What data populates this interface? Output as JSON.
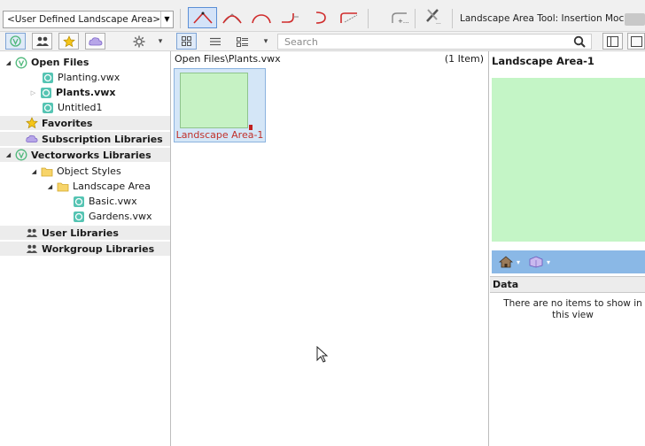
{
  "toolbar": {
    "class_select_value": "<User Defined Landscape Area>",
    "tool_mode_label": "Landscape Area Tool: Insertion Moc···",
    "mode_icons": [
      "polyline-corner-icon",
      "polyline-bezier-icon",
      "polyline-cubic-icon",
      "polyline-tangent-arc-icon",
      "polyline-point-arc-icon",
      "polyline-radius-icon",
      "rect-mode-icon",
      "settings-tools-icon"
    ]
  },
  "resource_manager": {
    "search_placeholder": "Search",
    "buttons": [
      "vectorworks-libraries-icon",
      "user-libraries-icon",
      "favorites-icon",
      "subscriptions-icon",
      "gear-icon",
      "grid-view-icon",
      "list-view-icon",
      "detail-view-icon",
      "search-icon",
      "panel-layout-icon"
    ]
  },
  "tree": {
    "items": [
      {
        "label": "Open Files",
        "bold": true,
        "expanded": true
      },
      {
        "label": "Planting.vwx",
        "bold": false
      },
      {
        "label": "Plants.vwx",
        "bold": true,
        "collapsed": true
      },
      {
        "label": "Untitled1",
        "bold": false
      },
      {
        "label": "Favorites",
        "bold": true
      },
      {
        "label": "Subscription Libraries",
        "bold": true
      },
      {
        "label": "Vectorworks Libraries",
        "bold": true,
        "expanded": true
      },
      {
        "label": "Object Styles",
        "bold": false,
        "expanded": true
      },
      {
        "label": "Landscape Area",
        "bold": false,
        "expanded": true
      },
      {
        "label": "Basic.vwx",
        "bold": false
      },
      {
        "label": "Gardens.vwx",
        "bold": false
      },
      {
        "label": "User Libraries",
        "bold": true
      },
      {
        "label": "Workgroup Libraries",
        "bold": true
      }
    ]
  },
  "browser": {
    "path": "Open Files\\Plants.vwx",
    "item_count": "(1 Item)",
    "items": [
      {
        "label": "Landscape Area-1"
      }
    ]
  },
  "preview": {
    "title": "Landscape Area-1",
    "data_header": "Data",
    "data_empty_text": "There are no items to show in this view"
  },
  "colors": {
    "selection_blue": "#d4e6f7",
    "preview_green": "#c4f5c6",
    "thumb_label_red": "#c0302a",
    "preview_bar_blue": "#8ab8e6"
  }
}
